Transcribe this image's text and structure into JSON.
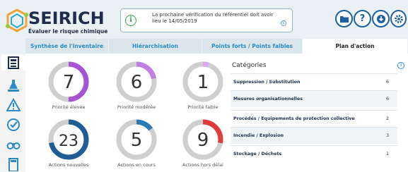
{
  "app": {
    "name": "SEIRICH",
    "tagline": "Évaluer le risque chimique"
  },
  "notice": {
    "text": "La prochaine vérification du référentiel doit avoir lieu le 14/05/2019"
  },
  "header_buttons": [
    {
      "icon": "folder-icon"
    },
    {
      "icon": "help-icon",
      "label": "?"
    },
    {
      "icon": "download-icon"
    },
    {
      "icon": "settings-icon"
    }
  ],
  "tabs": [
    {
      "label": "Synthèse de l'inventaire",
      "active": false
    },
    {
      "label": "Hiérarchisation",
      "active": false
    },
    {
      "label": "Points forts / Points faibles",
      "active": false
    },
    {
      "label": "Plan d'action",
      "active": true
    }
  ],
  "sidebar": [
    {
      "icon": "notebook-icon",
      "active": true
    },
    {
      "icon": "flask-hand-icon",
      "active": false
    },
    {
      "icon": "warning-icon",
      "active": false
    },
    {
      "icon": "check-circle-icon",
      "active": false
    },
    {
      "icon": "binoculars-icon",
      "active": false
    },
    {
      "icon": "calculator-icon",
      "active": false
    }
  ],
  "gauges": [
    {
      "value": "7",
      "label": "Priorité élevée",
      "fraction": 0.5,
      "color": "#a455d6"
    },
    {
      "value": "6",
      "label": "Priorité modérée",
      "fraction": 0.22,
      "color": "#c07fe3"
    },
    {
      "value": "1",
      "label": "Priorité faible",
      "fraction": 0.05,
      "color": "#d9a8ef"
    },
    {
      "value": "23",
      "label": "Actions nouvelles",
      "fraction": 0.72,
      "color": "#1f5d95"
    },
    {
      "value": "5",
      "label": "Actions en cours",
      "fraction": 0.15,
      "color": "#2a7ab8"
    },
    {
      "value": "9",
      "label": "Actions hors délai",
      "fraction": 0.28,
      "color": "#e23b3b"
    }
  ],
  "categories": {
    "title": "Catégories",
    "items": [
      {
        "name": "Suppression / Substitution",
        "count": "6"
      },
      {
        "name": "Mesures organisationnelles",
        "count": "6"
      },
      {
        "name": "Procédés / Equipements de protection collective",
        "count": "2"
      },
      {
        "name": "Incendie / Explosion",
        "count": "3"
      },
      {
        "name": "Stockage / Déchets",
        "count": "1"
      }
    ]
  },
  "colors": {
    "accent": "#2a8bc7",
    "dark": "#1e2e4a"
  }
}
